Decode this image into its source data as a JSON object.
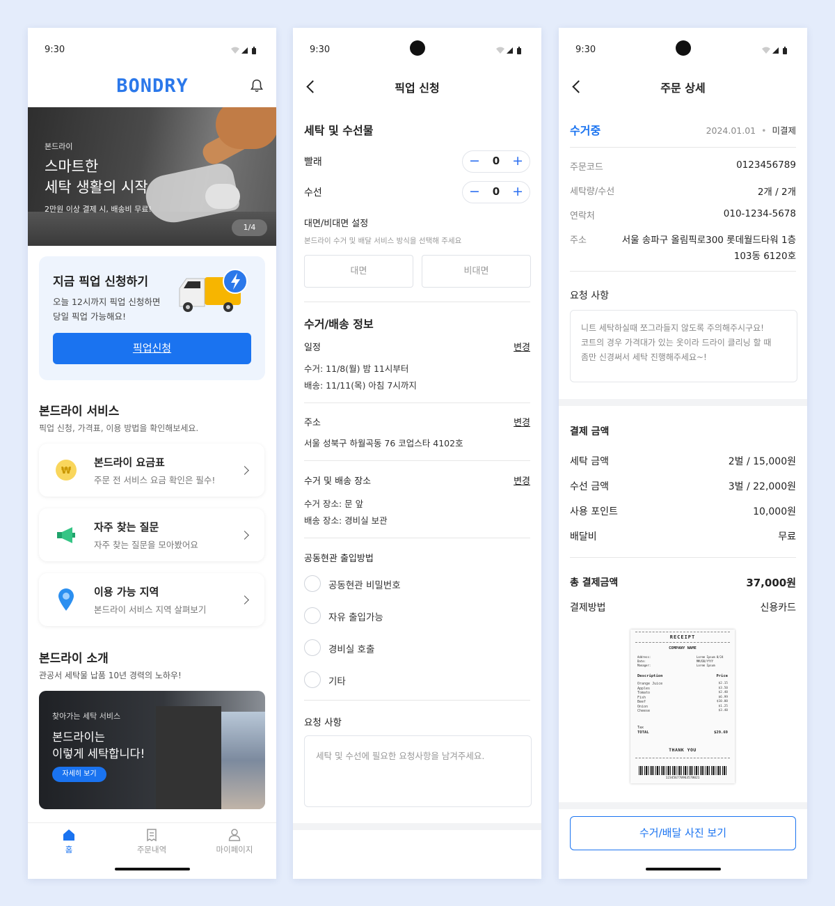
{
  "status": {
    "time": "9:30"
  },
  "home": {
    "logo": "BONDRY",
    "banner": {
      "kicker": "본드라이",
      "title1": "스마트한",
      "title2": "세탁 생활의 시작",
      "sub": "2만원 이상 결제 시, 배송비 무료!",
      "pager": "1/4"
    },
    "pickup": {
      "title": "지금 픽업 신청하기",
      "desc1": "오늘 12시까지 픽업 신청하면",
      "desc2": "당일 픽업 가능해요!",
      "button": "픽업신청"
    },
    "services": {
      "title": "본드라이 서비스",
      "sub": "픽업 신청, 가격표, 이용 방법을 확인해보세요.",
      "items": [
        {
          "title": "본드라이 요금표",
          "sub": "주문 전 서비스 요금 확인은 필수!",
          "icon": "won-coin-icon"
        },
        {
          "title": "자주 찾는 질문",
          "sub": "자주 찾는 질문을 모아봤어요",
          "icon": "megaphone-icon"
        },
        {
          "title": "이용 가능 지역",
          "sub": "본드라이 서비스 지역 살펴보기",
          "icon": "location-pin-icon"
        }
      ]
    },
    "intro": {
      "title": "본드라이 소개",
      "sub": "관공서 세탁물 납품 10년 경력의 노하우!",
      "card_kicker": "찾아가는 세탁 서비스",
      "card_title1": "본드라이는",
      "card_title2": "이렇게 세탁합니다!",
      "card_button": "자세히 보기"
    },
    "nav": {
      "home": "홈",
      "orders": "주문내역",
      "mypage": "마이페이지"
    }
  },
  "pickup_form": {
    "header": "픽업 신청",
    "section_items": "세탁 및 수선물",
    "laundry_label": "빨래",
    "laundry_qty": "0",
    "repair_label": "수선",
    "repair_qty": "0",
    "face_title": "대면/비대면 설정",
    "face_desc": "본드라이 수거 및 배달 서비스 방식을 선택해 주세요",
    "face_opt1": "대면",
    "face_opt2": "비대면",
    "delivery_title": "수거/배송 정보",
    "schedule_label": "일정",
    "change": "변경",
    "schedule_pickup": "수거: 11/8(월) 밤 11시부터",
    "schedule_delivery": "배송: 11/11(목) 아침 7시까지",
    "address_label": "주소",
    "address_value": "서울 성북구 하월곡동 76 코업스타 4102호",
    "place_label": "수거 및 배송 장소",
    "place_pickup": "수거 장소: 문 앞",
    "place_delivery": "배송 장소: 경비실 보관",
    "entry_title": "공동현관 출입방법",
    "entry_options": [
      "공동현관 비밀번호",
      "자유 출입가능",
      "경비실 호출",
      "기타"
    ],
    "request_title": "요청 사항",
    "request_placeholder": "세탁 및 수선에 필요한 요청사항을 남겨주세요."
  },
  "order": {
    "header": "주문 상세",
    "status": "수거중",
    "date": "2024.01.01",
    "dot": "•",
    "payment_status": "미결제",
    "code_label": "주문코드",
    "code": "0123456789",
    "qty_label": "세탁량/수선",
    "qty": "2개 / 2개",
    "phone_label": "연락처",
    "phone": "010-1234-5678",
    "addr_label": "주소",
    "addr1": "서울 송파구 올림픽로300 롯데월드타워 1층",
    "addr2": "103동 6120호",
    "request_title": "요청 사항",
    "request_text1": "니트 세탁하실때 쪼그라들지 않도록 주의해주시구요!",
    "request_text2": "코트의 경우 가격대가 있는 옷이라 드라이 클리닝 할 때",
    "request_text3": "좀만 신경써서 세탁 진행해주세요~!",
    "pay_title": "결제 금액",
    "wash_label": "세탁 금액",
    "wash": "2벌 / 15,000원",
    "repair_label": "수선 금액",
    "repair": "3벌 / 22,000원",
    "point_label": "사용 포인트",
    "point": "10,000원",
    "ship_label": "배달비",
    "ship": "무료",
    "total_label": "총 결제금액",
    "total": "37,000원",
    "method_label": "결제방법",
    "method": "신용카드",
    "photo_button": "수거/배달 사진 보기",
    "receipt": {
      "title": "RECEIPT",
      "company": "COMPANY NAME",
      "meta_labels": [
        "Address:",
        "Date:",
        "Manager:"
      ],
      "meta_values": [
        "Lorem Ipsum 8/24",
        "MM/DD/YYYY",
        "Lorem Ipsum"
      ],
      "desc_header": "Description",
      "price_header": "Price",
      "items": [
        "Orange Juice",
        "Apples",
        "Tomato",
        "Fish",
        "Beef",
        "Onion",
        "Cheese"
      ],
      "prices": [
        "$2.15",
        "$3.50",
        "$2.40",
        "$6.99",
        "$10.00",
        "$1.25",
        "$3.40"
      ],
      "tax": "Tax",
      "total_label": "TOTAL",
      "total": "$29.69",
      "thanks": "THANK YOU",
      "barcode": "123456778963578021"
    }
  },
  "colors": {
    "primary": "#1a73f0",
    "bg": "#e4ecfb",
    "dark_card": "#2c2f35"
  }
}
